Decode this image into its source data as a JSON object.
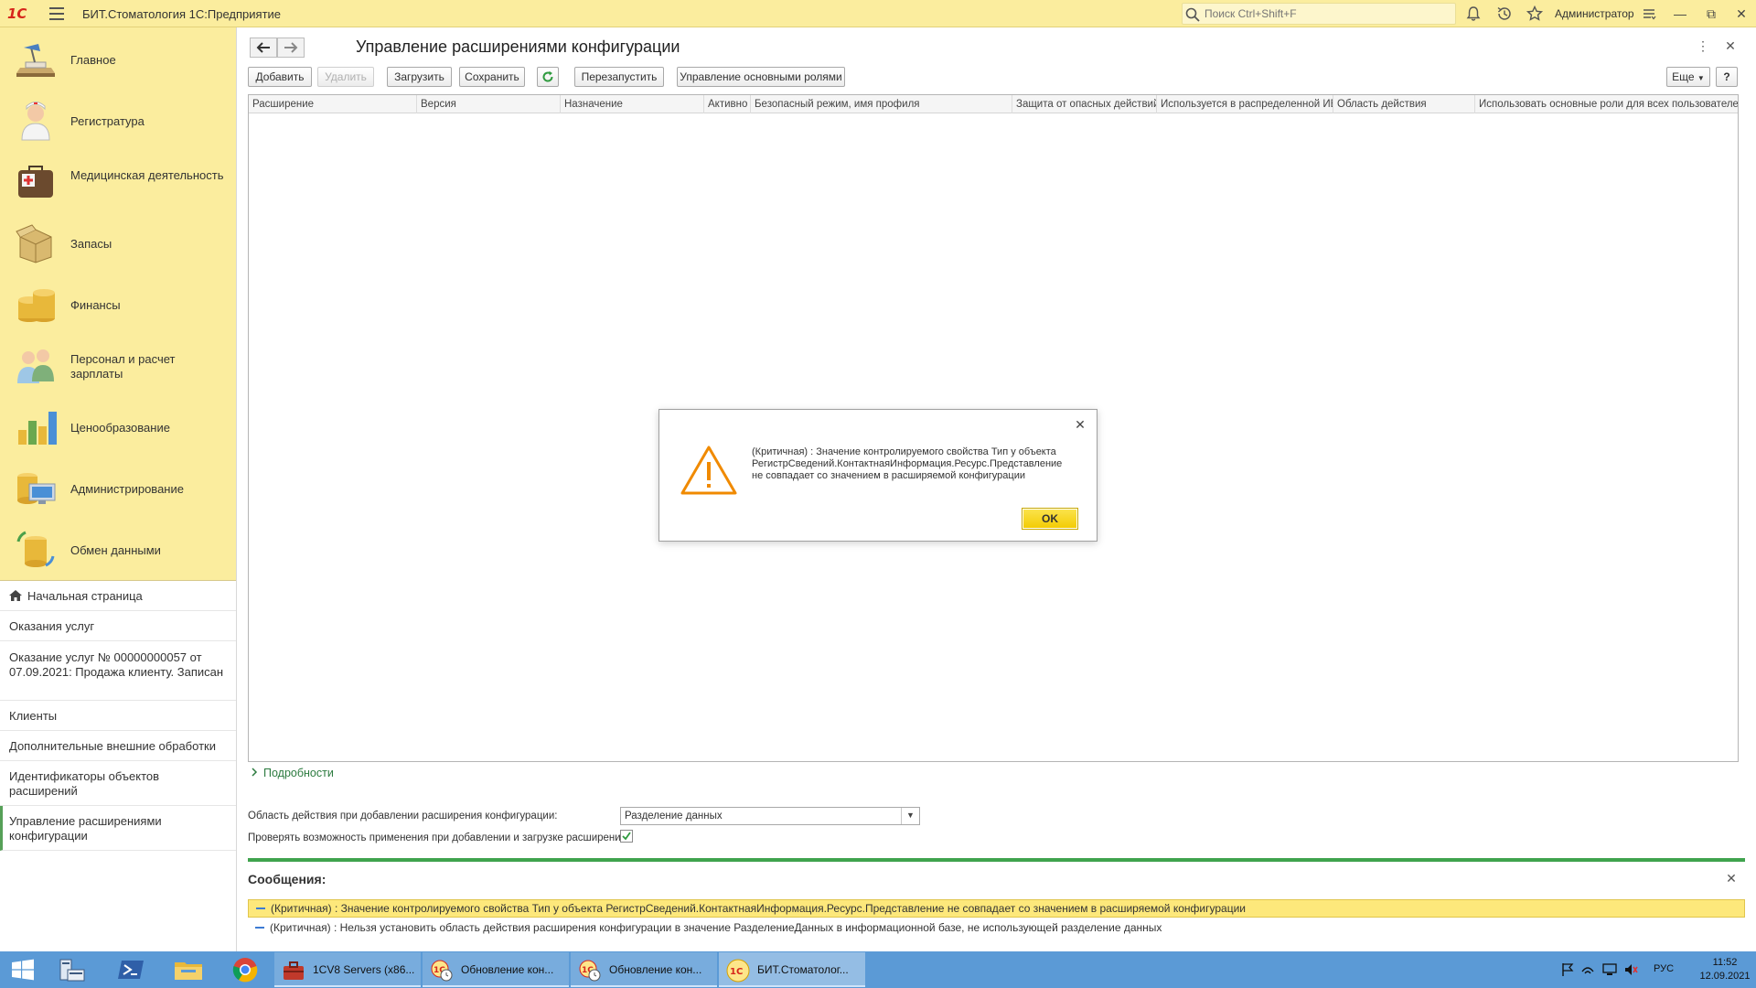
{
  "app": {
    "logo": "1С",
    "title": "БИТ.Стоматология 1С:Предприятие",
    "search_placeholder": "Поиск Ctrl+Shift+F",
    "user": "Администратор"
  },
  "sections": [
    {
      "label": "Главное",
      "icon": "desk-lamp-icon"
    },
    {
      "label": "Регистратура",
      "icon": "nurse-icon"
    },
    {
      "label": "Медицинская деятельность",
      "icon": "medical-bag-icon"
    },
    {
      "label": "Запасы",
      "icon": "box-icon"
    },
    {
      "label": "Финансы",
      "icon": "coins-icon"
    },
    {
      "label": "Персонал и расчет зарплаты",
      "icon": "staff-icon"
    },
    {
      "label": "Ценообразование",
      "icon": "bar-chart-icon"
    },
    {
      "label": "Администрирование",
      "icon": "computer-icon"
    },
    {
      "label": "Обмен данными",
      "icon": "database-exchange-icon"
    }
  ],
  "history": [
    {
      "label": "Начальная страница"
    },
    {
      "label": "Оказания услуг"
    },
    {
      "label": "Оказание услуг № 00000000057 от 07.09.2021: Продажа клиенту. Записан"
    },
    {
      "label": "Клиенты"
    },
    {
      "label": "Дополнительные внешние обработки"
    },
    {
      "label": "Идентификаторы объектов расширений"
    },
    {
      "label": "Управление расширениями конфигурации"
    }
  ],
  "form": {
    "title": "Управление расширениями конфигурации",
    "buttons": {
      "add": "Добавить",
      "delete": "Удалить",
      "load": "Загрузить",
      "save": "Сохранить",
      "restart": "Перезапустить",
      "roles": "Управление основными ролями",
      "more": "Еще",
      "help": "?"
    },
    "columns": [
      "Расширение",
      "Версия",
      "Назначение",
      "Активно",
      "Безопасный режим, имя профиля",
      "Защита от опасных действий",
      "Используется в распределенной ИБ",
      "Область действия",
      "Использовать основные роли для всех пользователей"
    ],
    "details_link": "Подробности",
    "scope_label": "Область действия при добавлении расширения конфигурации:",
    "scope_value": "Разделение данных",
    "check_label": "Проверять возможность применения при добавлении и загрузке расширений:",
    "check_value": "checked"
  },
  "messages": {
    "title": "Сообщения:",
    "items": [
      {
        "text": "(Критичная) : Значение контролируемого свойства Тип у объекта РегистрСведений.КонтактнаяИнформация.Ресурс.Представление не совпадает со значением в расширяемой конфигурации"
      },
      {
        "text": "(Критичная) : Нельзя установить область действия расширения конфигурации в значение РазделениеДанных в информационной базе, не использующей разделение данных"
      }
    ]
  },
  "dialog": {
    "line1": "(Критичная) : Значение контролируемого свойства Тип у объекта",
    "line2": "РегистрСведений.КонтактнаяИнформация.Ресурс.Представление",
    "line3": "не совпадает со значением в расширяемой конфигурации",
    "ok": "OK"
  },
  "taskbar": {
    "tasks": [
      {
        "label": "1CV8 Servers (x86..."
      },
      {
        "label": "Обновление кон..."
      },
      {
        "label": "Обновление кон..."
      },
      {
        "label": "БИТ.Стоматолог..."
      }
    ],
    "lang": "РУС",
    "time": "11:52",
    "date": "12.09.2021"
  },
  "colors": {
    "panel_yellow": "#fbed9e",
    "accent_green": "#3fa34d",
    "ok_yellow": "#f3cb00",
    "warning_orange": "#f08a00",
    "taskbar_blue": "#5b9ad6"
  }
}
